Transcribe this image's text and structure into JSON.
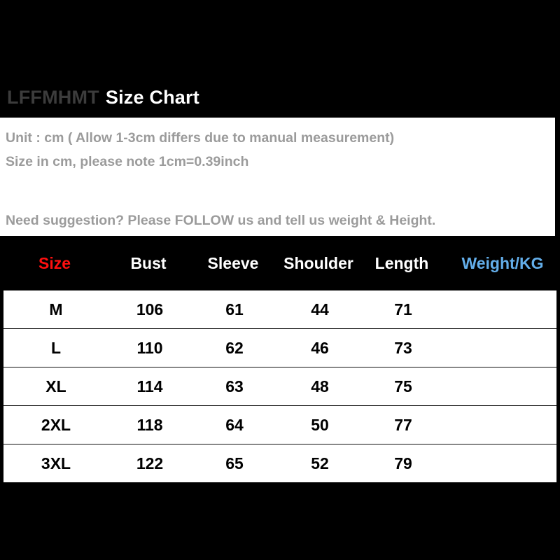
{
  "title": {
    "brand": "LFFMHMT",
    "main": "Size Chart"
  },
  "info": {
    "line1": "Unit : cm ( Allow 1-3cm differs due to manual measurement)",
    "line2": "Size in cm, please note 1cm=0.39inch",
    "line3": "Need suggestion? Please FOLLOW us and tell us weight & Height."
  },
  "colors": {
    "size_header": "#ff0f0f",
    "weight_header": "#63aeea",
    "header_text": "#ffffff",
    "background": "#000000",
    "panel": "#ffffff",
    "info_text": "#9b9b9b",
    "brand_text": "#3c3c3c"
  },
  "chart_data": {
    "type": "table",
    "title": "LFFMHMT Size Chart",
    "columns": [
      "Size",
      "Bust",
      "Sleeve",
      "Shoulder",
      "Length",
      "Weight/KG"
    ],
    "rows": [
      {
        "size": "M",
        "bust": "106",
        "sleeve": "61",
        "shoulder": "44",
        "length": "71",
        "weight": ""
      },
      {
        "size": "L",
        "bust": "110",
        "sleeve": "62",
        "shoulder": "46",
        "length": "73",
        "weight": ""
      },
      {
        "size": "XL",
        "bust": "114",
        "sleeve": "63",
        "shoulder": "48",
        "length": "75",
        "weight": ""
      },
      {
        "size": "2XL",
        "bust": "118",
        "sleeve": "64",
        "shoulder": "50",
        "length": "77",
        "weight": ""
      },
      {
        "size": "3XL",
        "bust": "122",
        "sleeve": "65",
        "shoulder": "52",
        "length": "79",
        "weight": ""
      }
    ]
  }
}
